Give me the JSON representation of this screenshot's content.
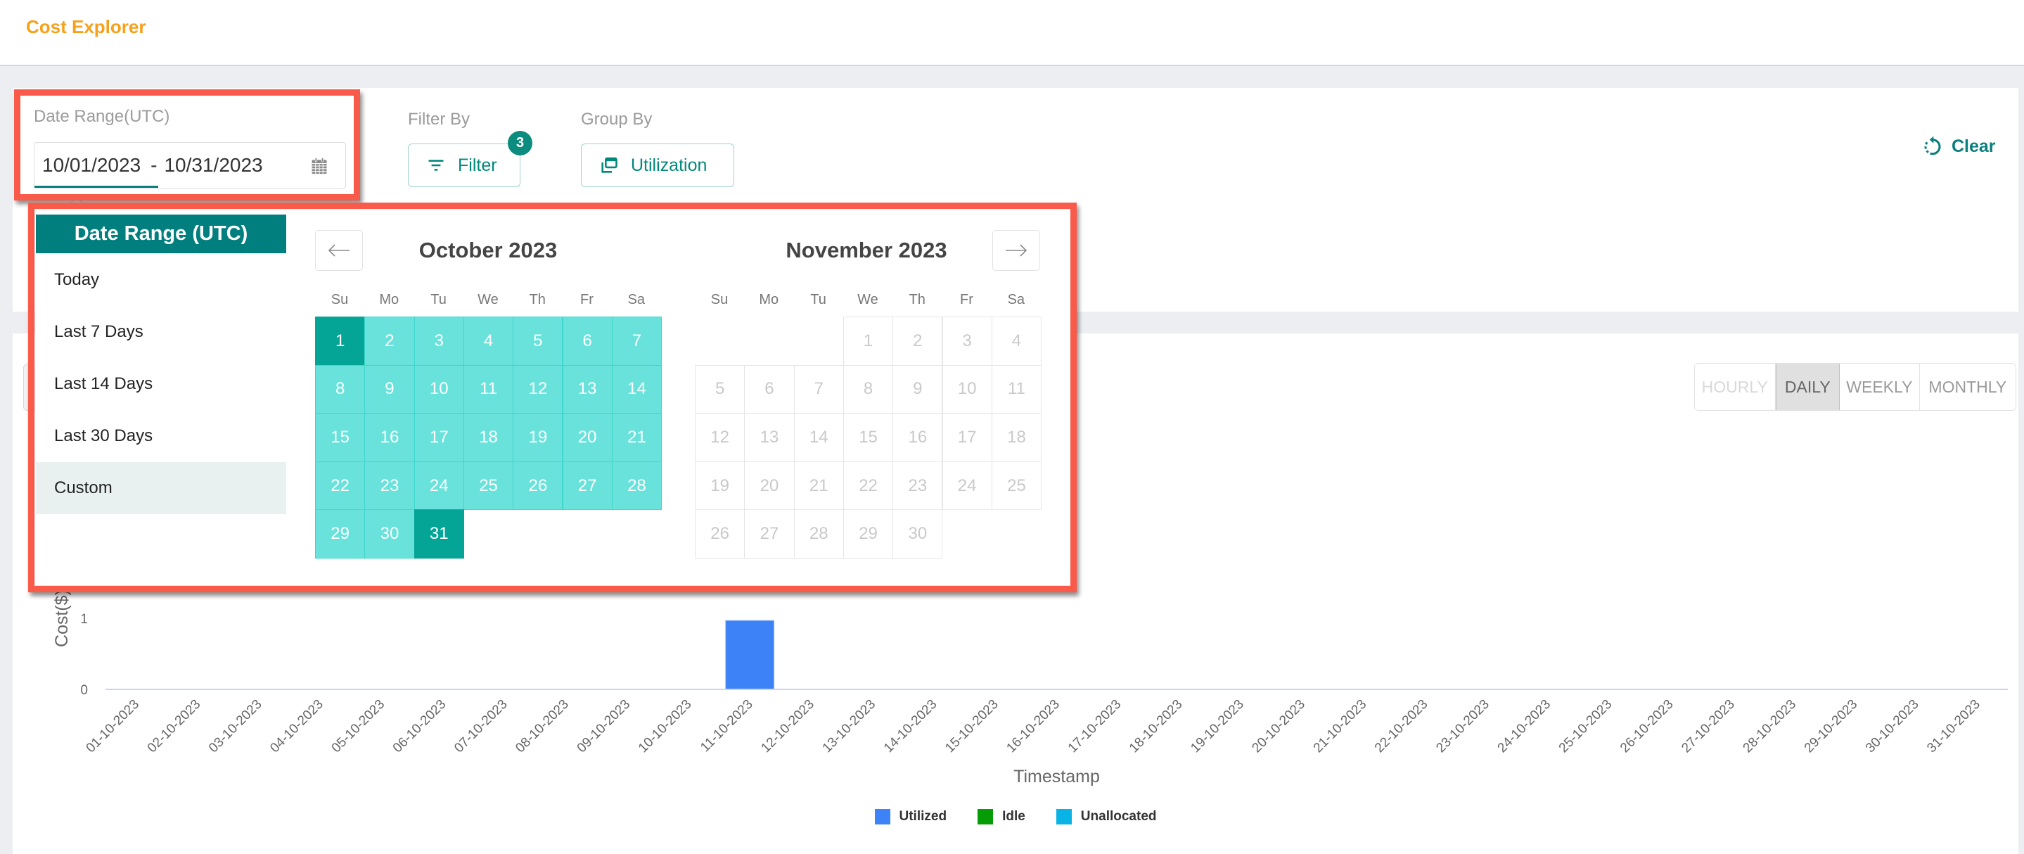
{
  "header": {
    "title": "Cost Explorer"
  },
  "colors": {
    "accent": "#00807f",
    "title": "#f7a11a",
    "range_fill": "#68e2da",
    "range_endpoint": "#04a496",
    "highlight": "#fa5a4a"
  },
  "filters": {
    "date_range": {
      "label": "Date Range(UTC)",
      "start": "10/01/2023",
      "separator": "-",
      "end": "10/31/2023",
      "icon": "calendar-icon"
    },
    "filter_by": {
      "label": "Filter By",
      "button_label": "Filter",
      "badge_count": "3",
      "icon": "filter-icon"
    },
    "group_by": {
      "label": "Group By",
      "button_label": "Utilization",
      "icon": "group-icon"
    },
    "clear": {
      "label": "Clear",
      "icon": "reset-icon"
    }
  },
  "date_picker": {
    "title": "Date Range (UTC)",
    "presets": [
      {
        "label": "Today",
        "selected": false
      },
      {
        "label": "Last 7 Days",
        "selected": false
      },
      {
        "label": "Last 14 Days",
        "selected": false
      },
      {
        "label": "Last 30 Days",
        "selected": false
      },
      {
        "label": "Custom",
        "selected": true
      }
    ],
    "prev_icon": "arrow-left-icon",
    "next_icon": "arrow-right-icon",
    "weekdays": [
      "Su",
      "Mo",
      "Tu",
      "We",
      "Th",
      "Fr",
      "Sa"
    ],
    "months": [
      {
        "title": "October 2023",
        "disabled": false,
        "range_start": 1,
        "range_end": 31,
        "weeks": [
          [
            1,
            2,
            3,
            4,
            5,
            6,
            7
          ],
          [
            8,
            9,
            10,
            11,
            12,
            13,
            14
          ],
          [
            15,
            16,
            17,
            18,
            19,
            20,
            21
          ],
          [
            22,
            23,
            24,
            25,
            26,
            27,
            28
          ],
          [
            29,
            30,
            31,
            null,
            null,
            null,
            null
          ]
        ]
      },
      {
        "title": "November 2023",
        "disabled": true,
        "weeks": [
          [
            null,
            null,
            null,
            1,
            2,
            3,
            4
          ],
          [
            5,
            6,
            7,
            8,
            9,
            10,
            11
          ],
          [
            12,
            13,
            14,
            15,
            16,
            17,
            18
          ],
          [
            19,
            20,
            21,
            22,
            23,
            24,
            25
          ],
          [
            26,
            27,
            28,
            29,
            30,
            null,
            null
          ]
        ]
      }
    ]
  },
  "granularity": {
    "options": [
      {
        "label": "HOURLY",
        "disabled": true,
        "selected": false
      },
      {
        "label": "DAILY",
        "disabled": false,
        "selected": true
      },
      {
        "label": "WEEKLY",
        "disabled": false,
        "selected": false
      },
      {
        "label": "MONTHLY",
        "disabled": false,
        "selected": false
      }
    ]
  },
  "chart_data": {
    "type": "bar",
    "stacked": true,
    "title": "",
    "xlabel": "Timestamp",
    "ylabel": "Cost($)",
    "ylim": [
      0,
      2
    ],
    "yticks": [
      0,
      1
    ],
    "grid": false,
    "legend_position": "bottom-center",
    "categories": [
      "01-10-2023",
      "02-10-2023",
      "03-10-2023",
      "04-10-2023",
      "05-10-2023",
      "06-10-2023",
      "07-10-2023",
      "08-10-2023",
      "09-10-2023",
      "10-10-2023",
      "11-10-2023",
      "12-10-2023",
      "13-10-2023",
      "14-10-2023",
      "15-10-2023",
      "16-10-2023",
      "17-10-2023",
      "18-10-2023",
      "19-10-2023",
      "20-10-2023",
      "21-10-2023",
      "22-10-2023",
      "23-10-2023",
      "24-10-2023",
      "25-10-2023",
      "26-10-2023",
      "27-10-2023",
      "28-10-2023",
      "29-10-2023",
      "30-10-2023",
      "31-10-2023"
    ],
    "series": [
      {
        "name": "Utilized",
        "color": "#3d82f6",
        "values": [
          0,
          0,
          0,
          0,
          0,
          0,
          0,
          0,
          0,
          0,
          0.97,
          0,
          0,
          0,
          0,
          0,
          0,
          0,
          0,
          0,
          0,
          0,
          0,
          0,
          0,
          0,
          0,
          0,
          0,
          0,
          0
        ]
      },
      {
        "name": "Idle",
        "color": "#069c06",
        "values": [
          0,
          0,
          0,
          0,
          0,
          0,
          0,
          0,
          0,
          0,
          0,
          0,
          0,
          0,
          0,
          0,
          0,
          0,
          0,
          0,
          0,
          0,
          0,
          0,
          0,
          0,
          0,
          0,
          0,
          0,
          0
        ]
      },
      {
        "name": "Unallocated",
        "color": "#0ab3e6",
        "values": [
          0,
          0,
          0,
          0,
          0,
          0,
          0,
          0,
          0,
          0,
          0,
          0,
          0,
          0,
          0,
          0,
          0,
          0,
          0,
          0,
          0,
          0,
          0,
          0,
          0,
          0,
          0,
          0,
          0,
          0,
          0
        ]
      }
    ]
  }
}
